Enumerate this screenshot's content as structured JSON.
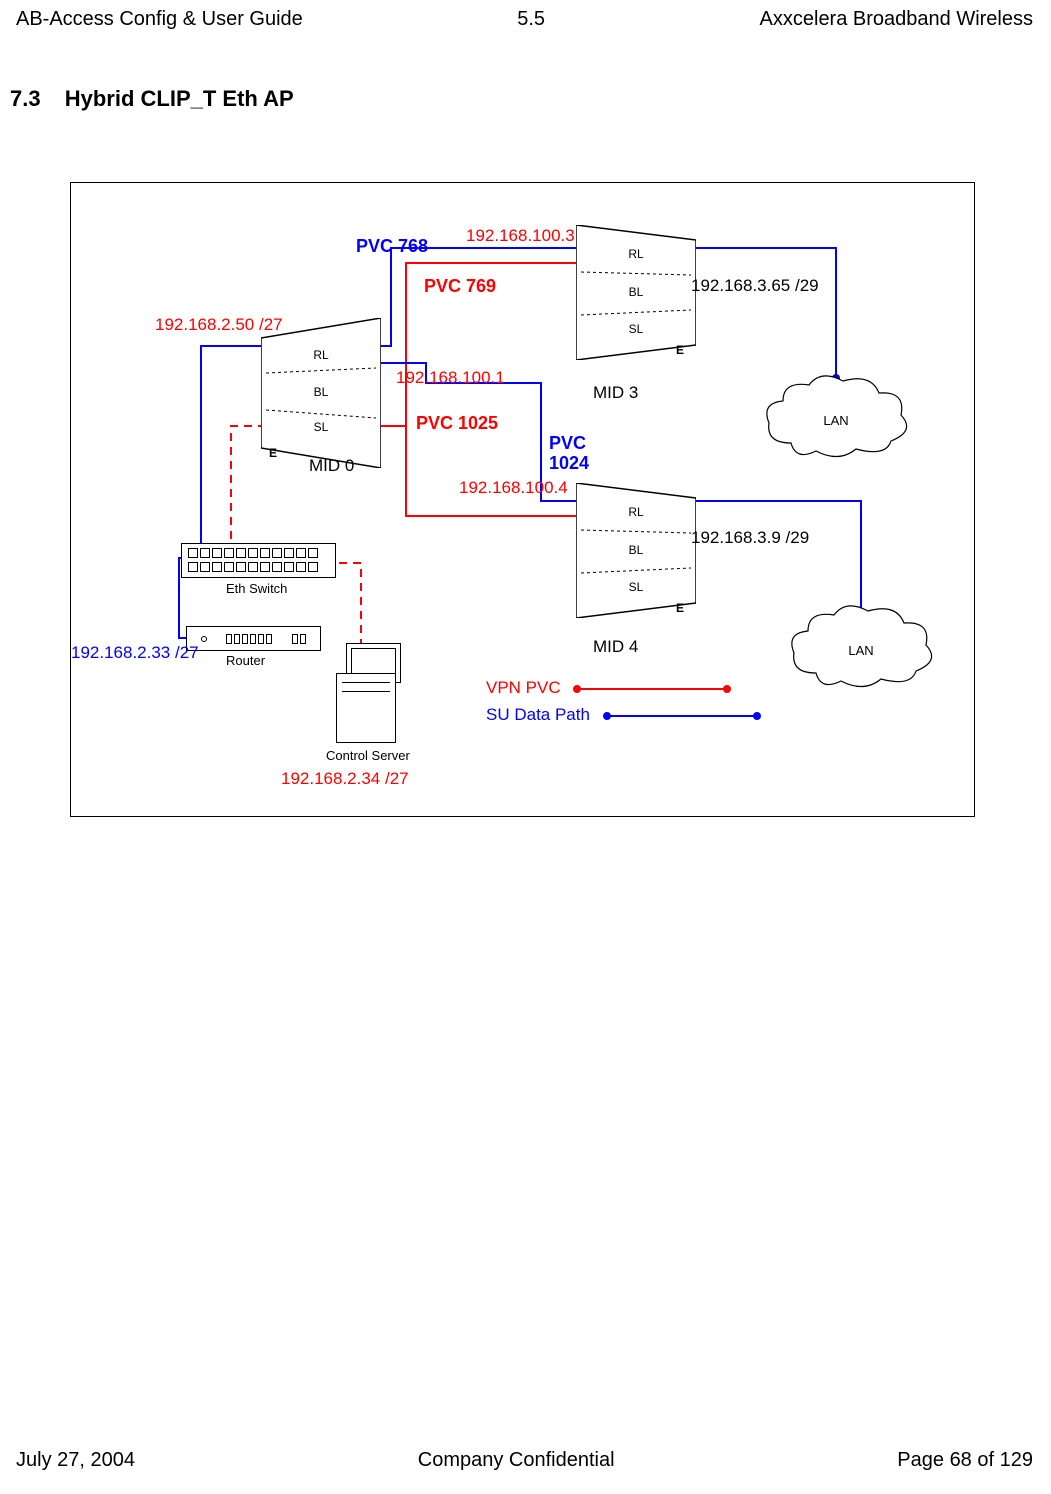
{
  "header": {
    "left": "AB-Access Config & User Guide",
    "center": "5.5",
    "right": "Axxcelera Broadband Wireless"
  },
  "footer": {
    "left": "July 27, 2004",
    "center": "Company Confidential",
    "right": "Page 68 of 129"
  },
  "section": {
    "number": "7.3",
    "title": "Hybrid CLIP_T Eth AP"
  },
  "labels": {
    "pvc768": "PVC 768",
    "pvc769": "PVC 769",
    "pvc1024_line1": "PVC",
    "pvc1024_line2": "1024",
    "pvc1025": "PVC 1025",
    "ip_100_3": "192.168.100.3",
    "ip_100_1": "192.168.100.1",
    "ip_100_4": "192.168.100.4",
    "ip_2_50": "192.168.2.50 /27",
    "ip_2_33": "192.168.2.33 /27",
    "ip_2_34": "192.168.2.34 /27",
    "ip_3_65": "192.168.3.65 /29",
    "ip_3_9": "192.168.3.9 /29",
    "mid0": "MID 0",
    "mid3": "MID 3",
    "mid4": "MID 4",
    "eth_switch": "Eth Switch",
    "router": "Router",
    "control_server": "Control Server",
    "lan": "LAN",
    "vpn_pvc": "VPN PVC",
    "su_data": "SU Data Path",
    "rl": "RL",
    "bl": "BL",
    "sl": "SL",
    "e": "E"
  }
}
